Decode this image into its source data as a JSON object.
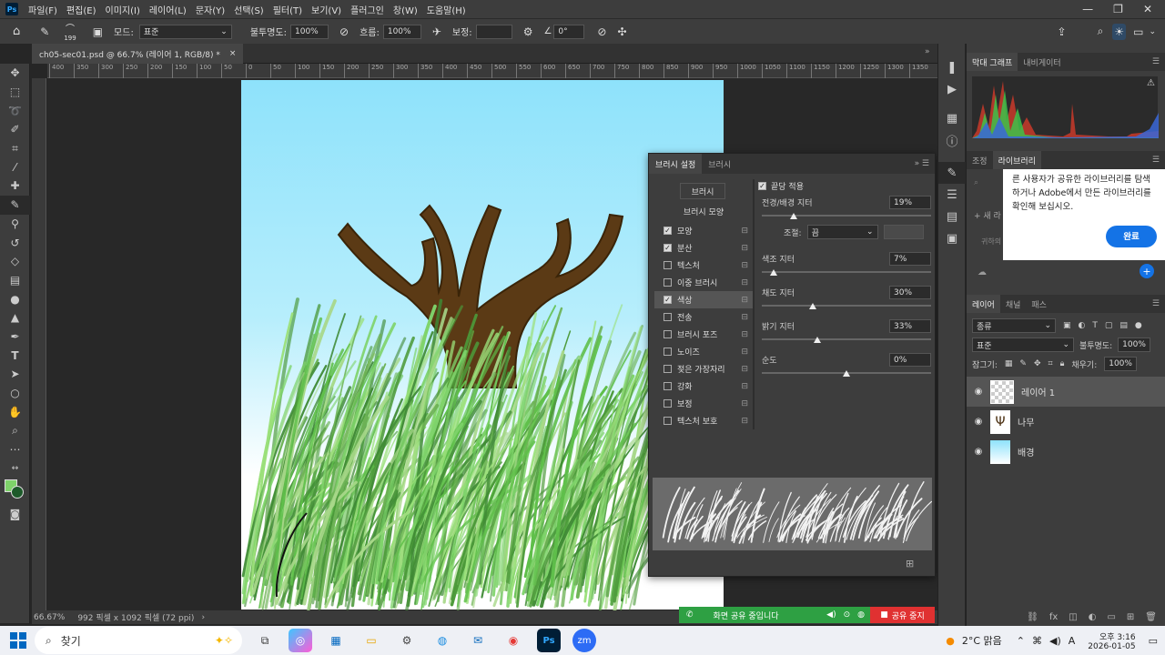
{
  "menubar": {
    "logo": "Ps",
    "items": [
      "파일(F)",
      "편집(E)",
      "이미지(I)",
      "레이어(L)",
      "문자(Y)",
      "선택(S)",
      "필터(T)",
      "보기(V)",
      "플러그인",
      "창(W)",
      "도움말(H)"
    ],
    "minimize": "—",
    "maximize": "❐",
    "close": "✕"
  },
  "options": {
    "brush_size": "199",
    "mode_label": "모드:",
    "mode_value": "표준",
    "opacity_label": "불투명도:",
    "opacity_value": "100%",
    "flow_label": "흐름:",
    "flow_value": "100%",
    "smoothing_label": "보정:",
    "angle_value": "0°"
  },
  "document": {
    "tab_title": "ch05-sec01.psd @ 66.7% (레이어 1, RGB/8) *",
    "close": "×",
    "ruler_ticks": [
      "400",
      "350",
      "300",
      "250",
      "200",
      "150",
      "100",
      "50",
      "0",
      "50",
      "100",
      "150",
      "200",
      "250",
      "300",
      "350",
      "400",
      "450",
      "500",
      "550",
      "600",
      "650",
      "700",
      "750",
      "800",
      "850",
      "900",
      "950",
      "1000",
      "1050",
      "1100",
      "1150",
      "1200",
      "1250",
      "1300",
      "1350"
    ]
  },
  "status": {
    "zoom": "66.67%",
    "size": "992 픽셀 x 1092 픽셀 (72 ppi)",
    "arrow": "›"
  },
  "brush_panel": {
    "tab_active": "브러시 설정",
    "tab_other": "브러시",
    "brushes_button": "브러시",
    "shape_label": "브러시 모양",
    "items": [
      {
        "label": "모양",
        "checked": true
      },
      {
        "label": "분산",
        "checked": true
      },
      {
        "label": "텍스처",
        "checked": false
      },
      {
        "label": "이중 브러시",
        "checked": false
      },
      {
        "label": "색상",
        "checked": true,
        "selected": true
      },
      {
        "label": "전송",
        "checked": false
      },
      {
        "label": "브러시 포즈",
        "checked": false
      },
      {
        "label": "노이즈",
        "checked": false
      },
      {
        "label": "젖은 가장자리",
        "checked": false
      },
      {
        "label": "강화",
        "checked": false
      },
      {
        "label": "보정",
        "checked": false
      },
      {
        "label": "텍스처 보호",
        "checked": false
      }
    ],
    "apply_per_tip": "끝당 적용",
    "fg_bg_label": "전경/배경 지터",
    "fg_bg_value": "19%",
    "fg_bg_level": 0.19,
    "control_label": "조절:",
    "control_value": "끔",
    "hue_label": "색조 지터",
    "hue_value": "7%",
    "hue_level": 0.07,
    "sat_label": "채도 지터",
    "sat_value": "30%",
    "sat_level": 0.3,
    "bright_label": "밝기 지터",
    "bright_value": "33%",
    "bright_level": 0.33,
    "purity_label": "순도",
    "purity_value": "0%",
    "purity_level": 0.5
  },
  "histogram": {
    "tab_active": "막대 그래프",
    "tab_other": "내비게이터",
    "warning": "⚠"
  },
  "library": {
    "tab_other": "조정",
    "tab_active": "라이브러리",
    "popup_text": "른 사용자가 공유한 라이브러리를 탐색하거나 Adobe에서 만든 라이브러리를 확인해 보십시오.",
    "popup_button": "완료",
    "new_label": "+ 새 라",
    "partial_text": "귀하의"
  },
  "layers": {
    "tabs": [
      "레이어",
      "채널",
      "패스"
    ],
    "kind": "종류",
    "blend": "표준",
    "opacity_label": "불투명도:",
    "opacity_value": "100%",
    "lock_label": "잠그기:",
    "fill_label": "채우기:",
    "fill_value": "100%",
    "items": [
      {
        "name": "레이어 1",
        "selected": true
      },
      {
        "name": "나무",
        "selected": false
      },
      {
        "name": "배경",
        "selected": false
      }
    ]
  },
  "share": {
    "text": "화면 공유 중입니다",
    "stop": "공유 중지"
  },
  "taskbar": {
    "search": "찾기",
    "weather": "2°C 맑음",
    "lang": "A",
    "time": "오후 3:16",
    "date": "2026-01-05"
  }
}
